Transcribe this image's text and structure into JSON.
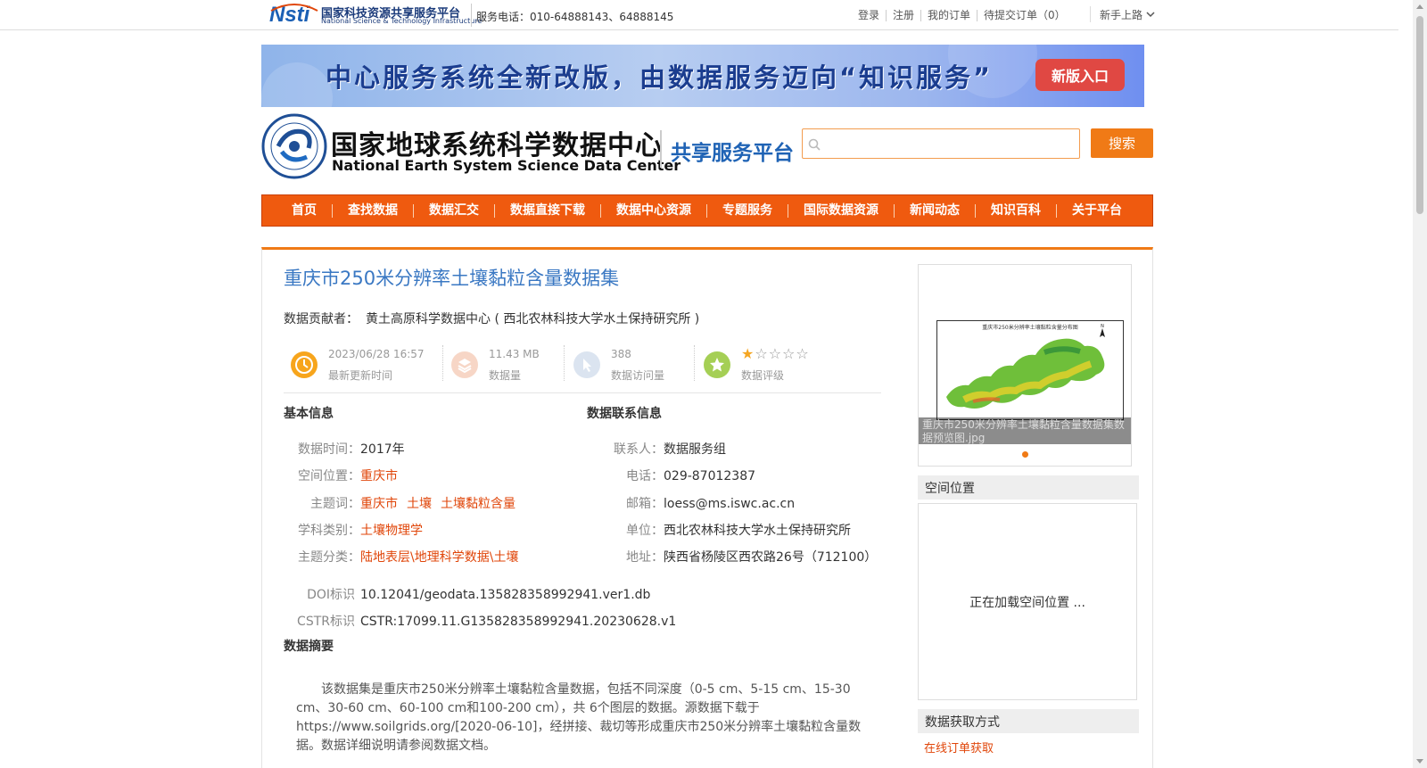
{
  "topbar": {
    "logo_text": "国家科技资源共享服务平台",
    "logo_sub": "National Science & Technology Infrastructure",
    "phone": "服务电话：010-64888143、64888145",
    "links": [
      "登录",
      "注册",
      "我的订单",
      "待提交订单（0）"
    ],
    "guide": "新手上路"
  },
  "banner": {
    "text": "中心服务系统全新改版，由数据服务迈向“知识服务”",
    "button": "新版入口"
  },
  "header": {
    "center_name_cn": "国家地球系统科学数据中心",
    "center_name_en": "National Earth System Science Data Center",
    "platform": "共享服务平台",
    "search_placeholder": "",
    "search_button": "搜索"
  },
  "nav": [
    "首页",
    "查找数据",
    "数据汇交",
    "数据直接下载",
    "数据中心资源",
    "专题服务",
    "国际数据资源",
    "新闻动态",
    "知识百科",
    "关于平台"
  ],
  "dataset": {
    "title": "重庆市250米分辨率土壤黏粒含量数据集",
    "contributor_label": "数据贡献者：",
    "contributor": "黄土高原科学数据中心 ( 西北农林科技大学水土保持研究所 )",
    "stats": {
      "updated_value": "2023/06/28 16:57",
      "updated_label": "最新更新时间",
      "size_value": "11.43 MB",
      "size_label": "数据量",
      "visits_value": "388",
      "visits_label": "数据访问量",
      "rating_label": "数据评级",
      "rating": 1,
      "rating_max": 5
    },
    "basic_title": "基本信息",
    "basic": {
      "time_label": "数据时间：",
      "time": "2017年",
      "space_label": "空间位置：",
      "space": "重庆市",
      "keywords_label": "主题词：",
      "keywords": [
        "重庆市",
        "土壤",
        "土壤黏粒含量"
      ],
      "discipline_label": "学科类别：",
      "discipline": "土壤物理学",
      "category_label": "主题分类：",
      "category": "陆地表层\\地理科学数据\\土壤"
    },
    "contact_title": "数据联系信息",
    "contact": {
      "person_label": "联系人：",
      "person": "数据服务组",
      "phone_label": "电话：",
      "phone": "029-87012387",
      "email_label": "邮箱：",
      "email": "loess@ms.iswc.ac.cn",
      "org_label": "单位：",
      "org": "西北农林科技大学水土保持研究所",
      "addr_label": "地址：",
      "addr": "陕西省杨陵区西农路26号（712100）"
    },
    "doi_label": "DOI标识",
    "doi": "10.12041/geodata.135828358992941.ver1.db",
    "cstr_label": "CSTR标识",
    "cstr": "CSTR:17099.11.G135828358992941.20230628.v1",
    "abstract_title": "数据摘要",
    "abstract": "该数据集是重庆市250米分辨率土壤黏粒含量数据，包括不同深度（0-5 cm、5-15 cm、15-30 cm、30-60 cm、60-100 cm和100-200 cm），共 6个图层的数据。源数据下载于https://www.soilgrids.org/[2020-06-10]，经拼接、裁切等形成重庆市250米分辨率土壤黏粒含量数据。数据详细说明请参阅数据文档。"
  },
  "sidebar": {
    "thumb_title": "重庆市250米分辨率土壤黏粒含量分布图",
    "thumb_caption": "重庆市250米分辨率土壤黏粒含量数据集数据预览图.jpg",
    "space_title": "空间位置",
    "space_loading": "正在加载空间位置 ...",
    "access_title": "数据获取方式",
    "access_link": "在线订单获取"
  },
  "colors": {
    "accent_orange": "#ef5a0f",
    "title_blue": "#3a78c3",
    "tag_red": "#e0460a"
  }
}
